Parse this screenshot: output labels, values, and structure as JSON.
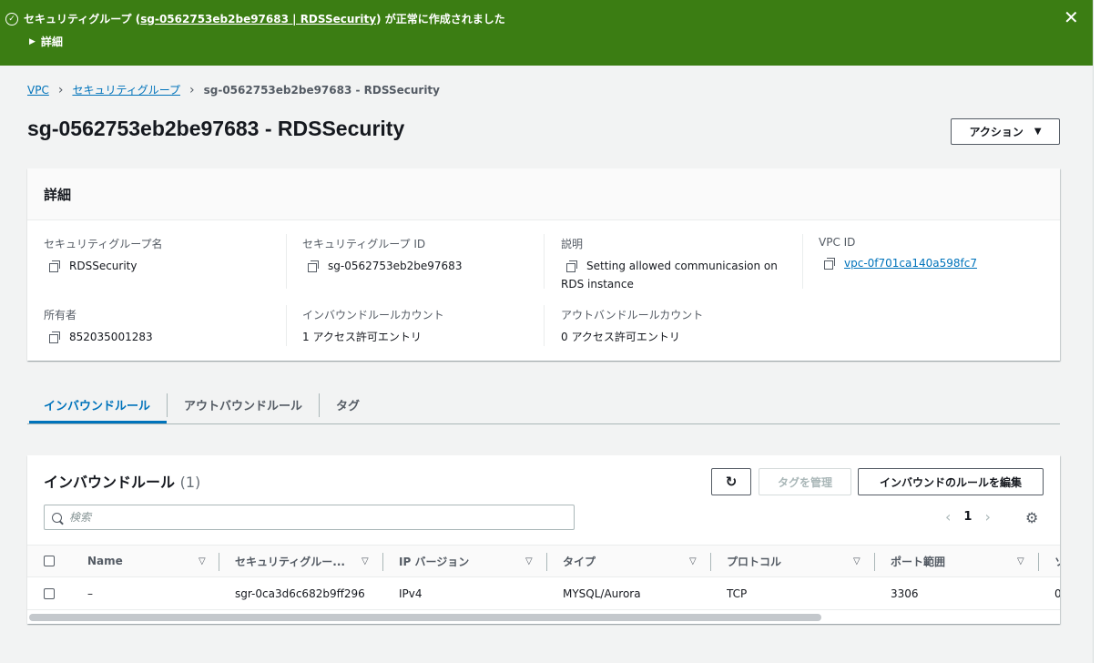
{
  "flash": {
    "prefix": "セキュリティグループ (",
    "link": "sg-0562753eb2be97683 | RDSSecurity",
    "suffix": ") が正常に作成されました",
    "details_label": "詳細",
    "status_color": "#3b7d13"
  },
  "breadcrumb": {
    "items": [
      "VPC",
      "セキュリティグループ"
    ],
    "current": "sg-0562753eb2be97683 - RDSSecurity"
  },
  "page": {
    "title": "sg-0562753eb2be97683 - RDSSecurity",
    "actions_label": "アクション"
  },
  "details": {
    "header": "詳細",
    "sg_name_label": "セキュリティグループ名",
    "sg_name": "RDSSecurity",
    "sg_id_label": "セキュリティグループ ID",
    "sg_id": "sg-0562753eb2be97683",
    "description_label": "説明",
    "description_line1": "Setting allowed communicasion on",
    "description_line2": "RDS instance",
    "vpc_id_label": "VPC ID",
    "vpc_id": "vpc-0f701ca140a598fc7",
    "owner_label": "所有者",
    "owner": "852035001283",
    "inbound_count_label": "インバウンドルールカウント",
    "inbound_count": "1 アクセス許可エントリ",
    "outbound_count_label": "アウトバンドルールカウント",
    "outbound_count": "0 アクセス許可エントリ"
  },
  "tabs": [
    "インバウンドルール",
    "アウトバウンドルール",
    "タグ"
  ],
  "rules": {
    "title": "インバウンドルール",
    "count": "(1)",
    "manage_tags_label": "タグを管理",
    "edit_label": "インバウンドのルールを編集",
    "search_placeholder": "検索",
    "page": "1",
    "columns": [
      "Name",
      "セキュリティグルー...",
      "IP バージョン",
      "タイプ",
      "プロトコル",
      "ポート範囲",
      "ソ"
    ],
    "rows": [
      [
        "–",
        "sgr-0ca3d6c682b9ff296",
        "IPv4",
        "MYSQL/Aurora",
        "TCP",
        "3306",
        "0"
      ]
    ]
  }
}
